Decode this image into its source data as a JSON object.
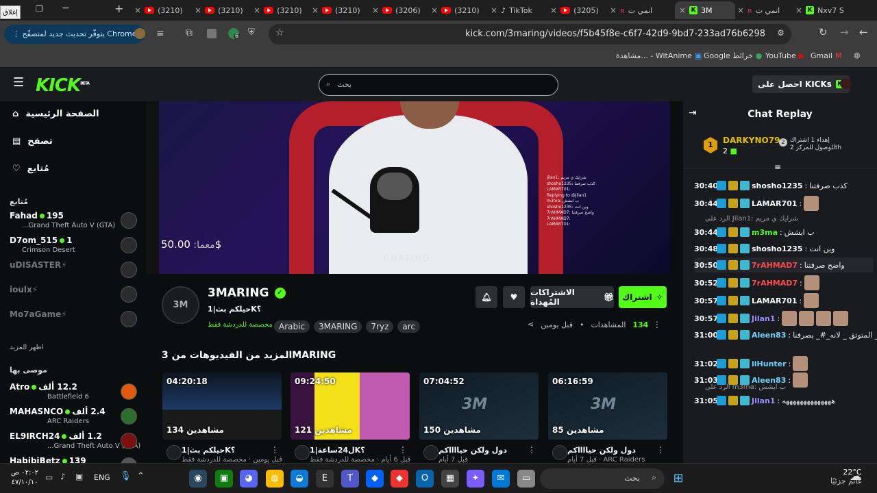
{
  "browser": {
    "close_text": "إغلاق",
    "tabs": [
      {
        "label": "(3210)",
        "type": "yt"
      },
      {
        "label": "(3210)",
        "type": "yt"
      },
      {
        "label": "(3210)",
        "type": "yt"
      },
      {
        "label": "(3210)",
        "type": "yt"
      },
      {
        "label": "(3206)",
        "type": "yt"
      },
      {
        "label": "(3210)",
        "type": "yt"
      },
      {
        "label": "TikTok",
        "type": "tt"
      },
      {
        "label": "(3205)",
        "type": "yt"
      },
      {
        "label": "انمي ت",
        "type": "ani"
      },
      {
        "label": "3M",
        "type": "kick"
      },
      {
        "label": "انمي ت",
        "type": "ani"
      },
      {
        "label": "Nxv7 S",
        "type": "kick"
      }
    ],
    "update_label": "يتوفّر تحديث جديد لمتصفّح Chrome",
    "url": "kick.com/3maring/videos/f5b45f8e-c6f7-42d9-9bd7-233ad76b6298",
    "extension_badge": "6",
    "bookmarks": [
      {
        "label": "Gmail",
        "icon": "gmail-icon"
      },
      {
        "label": "YouTube",
        "icon": "youtube-icon"
      },
      {
        "label": "Google خرائط",
        "icon": "maps-icon"
      },
      {
        "label": "مشاهدة... - WitAnime",
        "icon": "witanime-icon"
      }
    ]
  },
  "site": {
    "logo": "KICK",
    "logo_beta": "BETA",
    "search_placeholder": "بحث",
    "get_kicks": "احصل على KICKs",
    "nav": [
      {
        "label": "الصفحة الرئيسية",
        "icon": "home-icon"
      },
      {
        "label": "تصفح",
        "icon": "browse-icon"
      },
      {
        "label": "مُتابع",
        "icon": "heart-icon"
      }
    ],
    "following_header": "مُتابع",
    "following": [
      {
        "name": "Fahad",
        "viewers": "195",
        "game": "Grand Theft Auto V (GTA)...",
        "live": true
      },
      {
        "name": "D7om_515",
        "viewers": "1",
        "game": "Crimson Desert",
        "live": true
      },
      {
        "name": "uDISASTER",
        "viewers": "",
        "game": "",
        "live": false
      },
      {
        "name": "ioulx",
        "viewers": "",
        "game": "",
        "live": false
      },
      {
        "name": "Mo7aGame",
        "viewers": "",
        "game": "",
        "live": false
      }
    ],
    "show_more": "اظهر المزيد",
    "recommended_header": "موصى بها",
    "recommended": [
      {
        "name": "Atro",
        "viewers": "12.2 ألف",
        "game": "Battlefield 6"
      },
      {
        "name": "MAHASNCO",
        "viewers": "2.4 ألف",
        "game": "ARC Raiders"
      },
      {
        "name": "EL9IRCH24",
        "viewers": "1.2 ألف",
        "game": "Grand Theft Auto V (GTA)..."
      },
      {
        "name": "HabibiBetz",
        "viewers": "139",
        "game": ""
      }
    ]
  },
  "player": {
    "donation_label": "معما:",
    "donation_amount": "50.00$",
    "overlay_text": "CHATING",
    "mini_chat": [
      "Jilan1: شرايك ي مريم",
      "shosho1235: كذب صرفتنا",
      "LAMAR701:",
      "Replying to @Jilan1",
      "m3ma: ب ايشش",
      "shosho1235: وين انت",
      "7rAHMAD7: واضح صرفتنا",
      "7rAHMAD7:",
      "LAMAR701:"
    ]
  },
  "channel": {
    "avatar_text": "3M",
    "name": "3MARING",
    "video_title": "حيلكم بث|1K؟",
    "subtitle": "مخصصة للدردشة فقط",
    "tags": [
      "arc",
      "7ryz",
      "3MARING",
      "Arabic"
    ],
    "views_count": "134",
    "views_label": "المشاهدات",
    "time_ago": "قبل يومين",
    "subscribe_label": "اشتراك",
    "gift_label": "الاشتراكات المُهداة"
  },
  "more_videos": {
    "title": "المزيد من الفيديوهات من 3MARING",
    "cards": [
      {
        "duration": "04:20:18",
        "views": "134 مشاهدين",
        "title": "حيلكم بث|1K؟",
        "date": "قبل يومين · مخصصة للدردشة فقط",
        "style": "game"
      },
      {
        "duration": "09:24:50",
        "views": "121 مشاهدين",
        "title": "ل24ساعة|1K؟",
        "date": "قبل 6 أيام · مخصصة للدردشة فقط",
        "style": "desk"
      },
      {
        "duration": "07:04:52",
        "views": "150 مشاهدين",
        "title": "دول ولكن حيااااكم",
        "date": "قبل 7 أيام",
        "style": "logo"
      },
      {
        "duration": "06:16:59",
        "views": "85 مشاهدين",
        "title": "دول ولكن حيااااكم",
        "date": "قبل 7 أيام · ARC Raiders",
        "style": "logo"
      }
    ]
  },
  "chat": {
    "title": "Chat Replay",
    "pinned": {
      "rank1_user": "DARKYNO79",
      "rank1_count": "2",
      "rank2_text": "إهداء 1 اشتراك للوصول للمركز 2th"
    },
    "messages": [
      {
        "time": "30:40",
        "user": "shosho1235",
        "color": "#ffffff",
        "text": "كذب صرفتنا",
        "emotes": 0,
        "reply": ""
      },
      {
        "time": "30:44",
        "user": "LAMAR701",
        "color": "#ffffff",
        "text": "",
        "emotes": 1,
        "reply": ""
      },
      {
        "time": "30:44",
        "user": "m3ma",
        "color": "#53fc18",
        "text": "ب ايشش",
        "emotes": 0,
        "reply": "الرد على Jilan1: شرايك ي مريم"
      },
      {
        "time": "30:48",
        "user": "shosho1235",
        "color": "#ffffff",
        "text": "وين انت",
        "emotes": 0,
        "reply": ""
      },
      {
        "time": "30:50",
        "user": "7rAHMAD7",
        "color": "#ff4a4a",
        "text": "واضح صرفتنا",
        "emotes": 0,
        "reply": ""
      },
      {
        "time": "30:52",
        "user": "7rAHMAD7",
        "color": "#ff4a4a",
        "text": "",
        "emotes": 1,
        "reply": ""
      },
      {
        "time": "30:57",
        "user": "LAMAR701",
        "color": "#ffffff",
        "text": "",
        "emotes": 1,
        "reply": ""
      },
      {
        "time": "30:57",
        "user": "Jilan1",
        "color": "#9d8cff",
        "text": "",
        "emotes": 4,
        "reply": ""
      },
      {
        "time": "31:00",
        "user": "Aleen83",
        "color": "#6fd3ff",
        "text": "كنسلة_ عمار_ المتوتق _ لانه_#_ يصرفنا",
        "emotes": 0,
        "reply": ""
      },
      {
        "time": "31:02",
        "user": "iiHunter",
        "color": "#6fd3ff",
        "text": "",
        "emotes": 1,
        "reply": ""
      },
      {
        "time": "31:03",
        "user": "Aleen83",
        "color": "#6fd3ff",
        "text": "",
        "emotes": 1,
        "reply": ""
      },
      {
        "time": "31:05",
        "user": "Jilan1",
        "color": "#9d8cff",
        "text": "ههههههههههههههه",
        "emotes": 0,
        "reply": "الرد على m3ma: ب ايشش"
      }
    ]
  },
  "taskbar": {
    "search_placeholder": "بحث",
    "weather_temp": "22°C",
    "weather_text": "غائم جزئيًا",
    "time": "٠٢:٠٢ ص",
    "date": "٤٧/١٠/١٠",
    "lang": "ENG"
  }
}
